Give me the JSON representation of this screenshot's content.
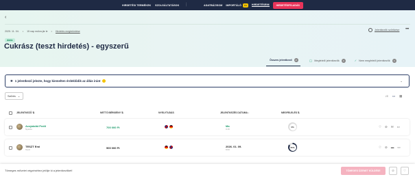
{
  "nav": {
    "left_links": [
      "HIRDETÉSI TERMÉKEK",
      "SZOLGÁLTATÁSOK"
    ],
    "right_links": [
      "ADATBÁZISOM",
      "IMPORTÁLÓ",
      "HIRDETÉSEIM"
    ],
    "import_badge": "ÚJ",
    "post_button": "HIRDETÉSFELADÁS"
  },
  "hero": {
    "meta": [
      "2025. 11. 04.",
      "15 nap múlva jár le",
      "Hirdetés megtekintése"
    ],
    "followers_label": "Jelentkezők szűrőzése",
    "status": "Aktív",
    "title": "Cukrász (teszt hirdetés) - egyszerű",
    "tabs": [
      {
        "label": "Összes jelentkező",
        "count": "2"
      },
      {
        "label": "Megfelelő jelentkezők",
        "count": "0"
      },
      {
        "label": "Nem megfelelő jelentkezők",
        "count": "0"
      }
    ]
  },
  "banner": {
    "text": "1 jelentkező jelezte, hogy kiemelten érdeklődik az állás iránt"
  },
  "toolbar": {
    "sort_label": "Szűrés"
  },
  "table": {
    "headers": [
      "JELENTKEZŐ",
      "NETTÓ BÉRIGÉNY",
      "NYELVTUDÁS",
      "JELENTKEZÉS DÁTUMA",
      "MEGFELELÉS"
    ],
    "rows": [
      {
        "name": "Acsjatolát Pedő",
        "sub": "Nyelvtu",
        "salary": "700 000 Ft",
        "date": "Ma",
        "time": "9:15",
        "match": "0%",
        "match_value": 0,
        "name_color": "#1a9a6a",
        "salary_color": "#1a9a6a",
        "date_color": "#1a9a6a"
      },
      {
        "name": "TESZT Emi",
        "sub": "Teszt",
        "salary": "500 000 Ft",
        "date": "2026. 01. 09.",
        "time": "8:00",
        "match": "85%",
        "match_value": 85,
        "name_color": "#222222",
        "salary_color": "#222222",
        "date_color": "#222222"
      }
    ]
  },
  "footer": {
    "hint": "Tömeges művelet végzéséhez jelölje ki a jelentkezőket!",
    "bulk_button": "TÖMEGES ÜZENET KÜLDÉSE"
  },
  "colors": {
    "brand": "#1f2a44",
    "accent": "#e8345a",
    "success": "#1a9a6a"
  }
}
